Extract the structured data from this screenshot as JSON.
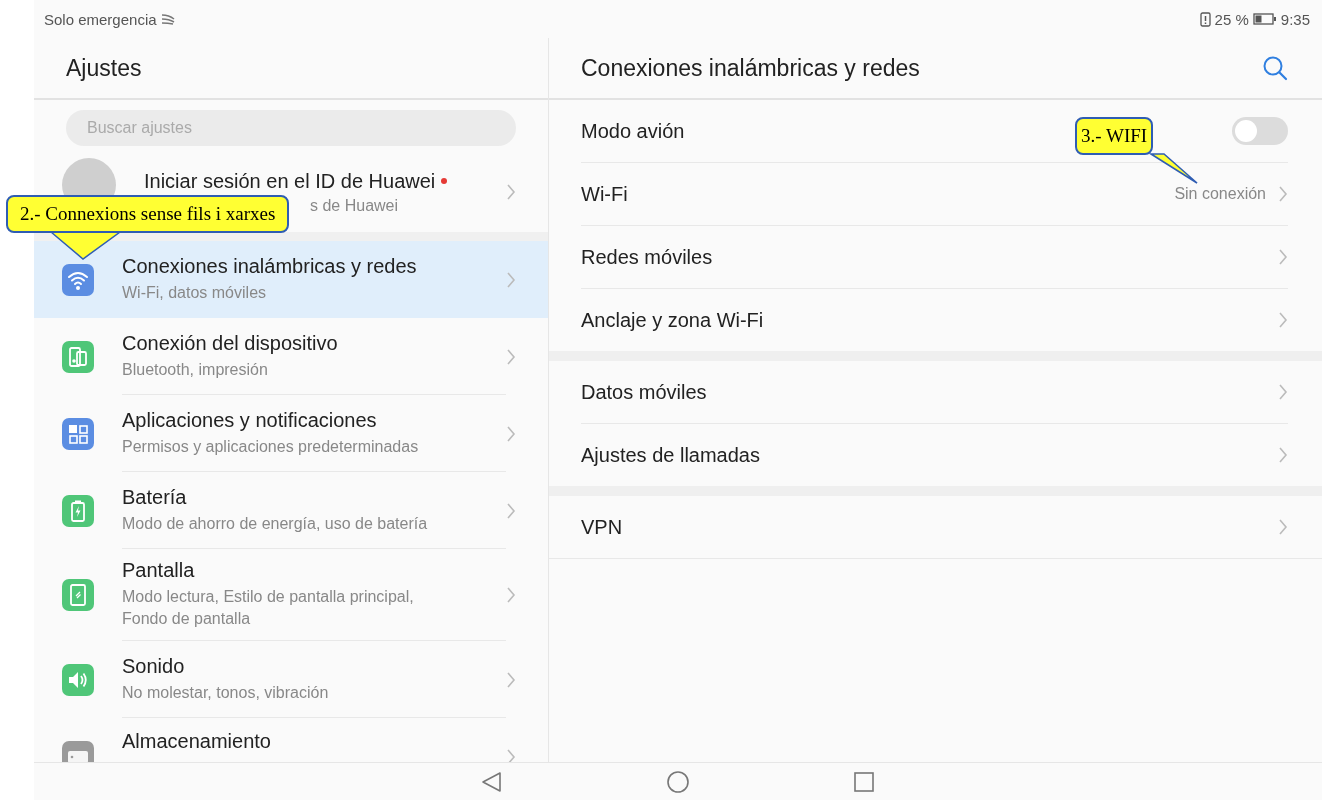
{
  "status_bar": {
    "carrier": "Solo emergencia",
    "battery_percent": "25 %",
    "time": "9:35"
  },
  "sidebar": {
    "title": "Ajustes",
    "search": {
      "placeholder": "Buscar ajustes"
    },
    "account": {
      "title": "Iniciar sesión en el ID de Huawei",
      "subtitle": "s de Huawei",
      "notification": true
    },
    "items": [
      {
        "title": "Conexiones inalámbricas y redes",
        "subtitle": "Wi-Fi, datos móviles",
        "color": "#5b8de2",
        "selected": true
      },
      {
        "title": "Conexión del dispositivo",
        "subtitle": "Bluetooth, impresión",
        "color": "#4fc678",
        "selected": false
      },
      {
        "title": "Aplicaciones y notificaciones",
        "subtitle": "Permisos y aplicaciones predeterminadas",
        "color": "#5b8de2",
        "selected": false
      },
      {
        "title": "Batería",
        "subtitle": "Modo de ahorro de energía, uso de batería",
        "color": "#4fc678",
        "selected": false
      },
      {
        "title": "Pantalla",
        "subtitle": "Modo lectura, Estilo de pantalla principal, Fondo de pantalla",
        "color": "#4fc678",
        "selected": false
      },
      {
        "title": "Sonido",
        "subtitle": "No molestar, tonos, vibración",
        "color": "#4fc678",
        "selected": false
      },
      {
        "title": "Almacenamiento",
        "color": "#9a9a9a",
        "selected": false
      }
    ]
  },
  "detail": {
    "title": "Conexiones inalámbricas y redes",
    "groups": [
      [
        {
          "kind": "toggle",
          "label": "Modo avión",
          "on": false
        },
        {
          "kind": "link",
          "label": "Wi-Fi",
          "value": "Sin conexión"
        },
        {
          "kind": "link",
          "label": "Redes móviles"
        },
        {
          "kind": "link",
          "label": "Anclaje y zona Wi-Fi"
        }
      ],
      [
        {
          "kind": "link",
          "label": "Datos móviles"
        },
        {
          "kind": "link",
          "label": "Ajustes de llamadas"
        }
      ],
      [
        {
          "kind": "link",
          "label": "VPN"
        }
      ]
    ]
  },
  "annotations": [
    {
      "text": "2.- Connexions sense fils i xarxes"
    },
    {
      "text": "3.- WIFI"
    }
  ]
}
